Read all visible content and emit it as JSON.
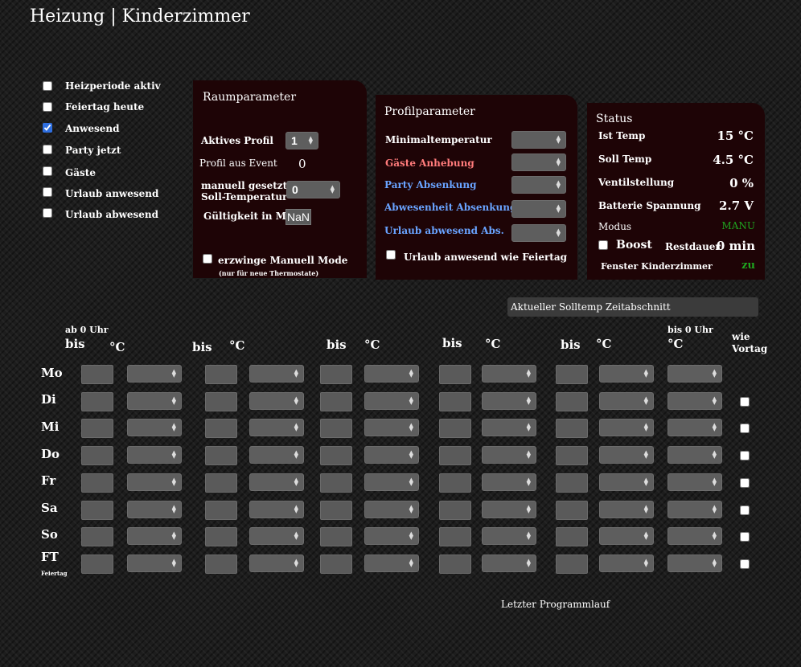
{
  "page_title": "Heizung | Kinderzimmer",
  "flags": [
    {
      "label": "Heizperiode aktiv",
      "checked": false
    },
    {
      "label": "Feiertag heute",
      "checked": false
    },
    {
      "label": "Anwesend",
      "checked": true
    },
    {
      "label": "Party jetzt",
      "checked": false
    },
    {
      "label": "Gäste",
      "checked": false
    },
    {
      "label": "Urlaub anwesend",
      "checked": false
    },
    {
      "label": "Urlaub abwesend",
      "checked": false
    }
  ],
  "room": {
    "title": "Raumparameter",
    "active_profile_label": "Aktives Profil",
    "active_profile_value": "1",
    "profile_event_label": "Profil aus Event",
    "profile_event_value": "0",
    "manual_label_1": "manuell gesetzte",
    "manual_label_2": "Soll-Temperatur",
    "manual_value": "0",
    "validity_label": "Gültigkeit in Min",
    "validity_value": "NaN",
    "force_manual_label": "erzwinge Manuell Mode",
    "force_manual_note": "(nur für neue Thermostate)"
  },
  "profile": {
    "title": "Profilparameter",
    "min_temp": "Minimaltemperatur",
    "guests_raise": "Gäste Anhebung",
    "party_lower": "Party Absenkung",
    "absence_lower": "Abwesenheit Absenkung",
    "holiday_away": "Urlaub abwesend Abs.",
    "holiday_present_label": "Urlaub anwesend wie Feiertag"
  },
  "status": {
    "title": "Status",
    "ist_label": "Ist Temp",
    "ist_value": "15 °C",
    "soll_label": "Soll Temp",
    "soll_value": "4.5 °C",
    "valve_label": "Ventilstellung",
    "valve_value": "0 %",
    "battery_label": "Batterie Spannung",
    "battery_value": "2.7 V",
    "mode_label": "Modus",
    "mode_value": "MANU",
    "boost_label": "Boost",
    "remaining_label": "Restdauer",
    "remaining_value": "0 min",
    "window_label": "Fenster Kinderzimmer",
    "window_value": "zu"
  },
  "current_section_label": "Aktueller Solltemp Zeitabschnitt",
  "schedule": {
    "from_midnight": "ab 0 Uhr",
    "to_midnight": "bis 0 Uhr",
    "bis": "bis",
    "deg": "°C",
    "wie": "wie",
    "vortag": "Vortag",
    "days": [
      "Mo",
      "Di",
      "Mi",
      "Do",
      "Fr",
      "Sa",
      "So",
      "FT"
    ],
    "holiday_note": "Feiertag"
  },
  "last_run_label": "Letzter Programmlauf",
  "colors": {
    "panel": "#1e0406",
    "pink": "#ff7b7b",
    "blue": "#69a3ff",
    "green": "#1fa51f",
    "check": "#2f6fe0"
  }
}
